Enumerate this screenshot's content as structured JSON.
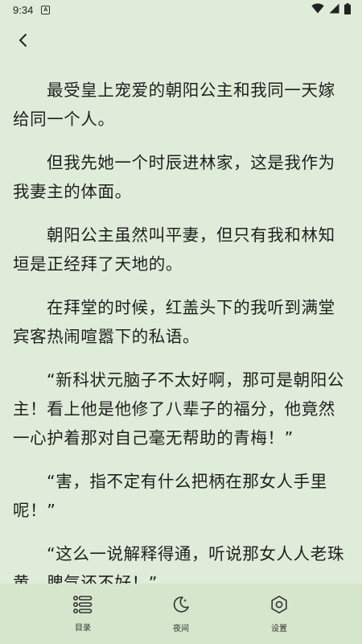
{
  "status_bar": {
    "time": "9:34",
    "notification_glyph": "A",
    "icons": [
      "wifi-icon",
      "signal-icon",
      "battery-icon"
    ]
  },
  "top_bar": {
    "back_icon": "chevron-left-icon"
  },
  "content": {
    "paragraphs": [
      "最受皇上宠爱的朝阳公主和我同一天嫁给同一个人。",
      "但我先她一个时辰进林家，这是我作为我妻主的体面。",
      "朝阳公主虽然叫平妻，但只有我和林知垣是正经拜了天地的。",
      "在拜堂的时候，红盖头下的我听到满堂宾客热闹喧嚣下的私语。",
      "“新科状元脑子不太好啊，那可是朝阳公主！看上他是他修了八辈子的福分，他竟然一心护着那对自己毫无帮助的青梅！”",
      "“害，指不定有什么把柄在那女人手里呢！”",
      "“这么一说解释得通，听说那女人人老珠黄，脾气还不好！”"
    ]
  },
  "bottom_bar": {
    "items": [
      {
        "label": "目录",
        "icon": "catalog-icon"
      },
      {
        "label": "夜间",
        "icon": "moon-icon"
      },
      {
        "label": "设置",
        "icon": "gear-icon"
      }
    ]
  },
  "colors": {
    "background": "#dfecd9",
    "bottom_bar": "#d5e6cd",
    "text": "#1f1f1f"
  }
}
